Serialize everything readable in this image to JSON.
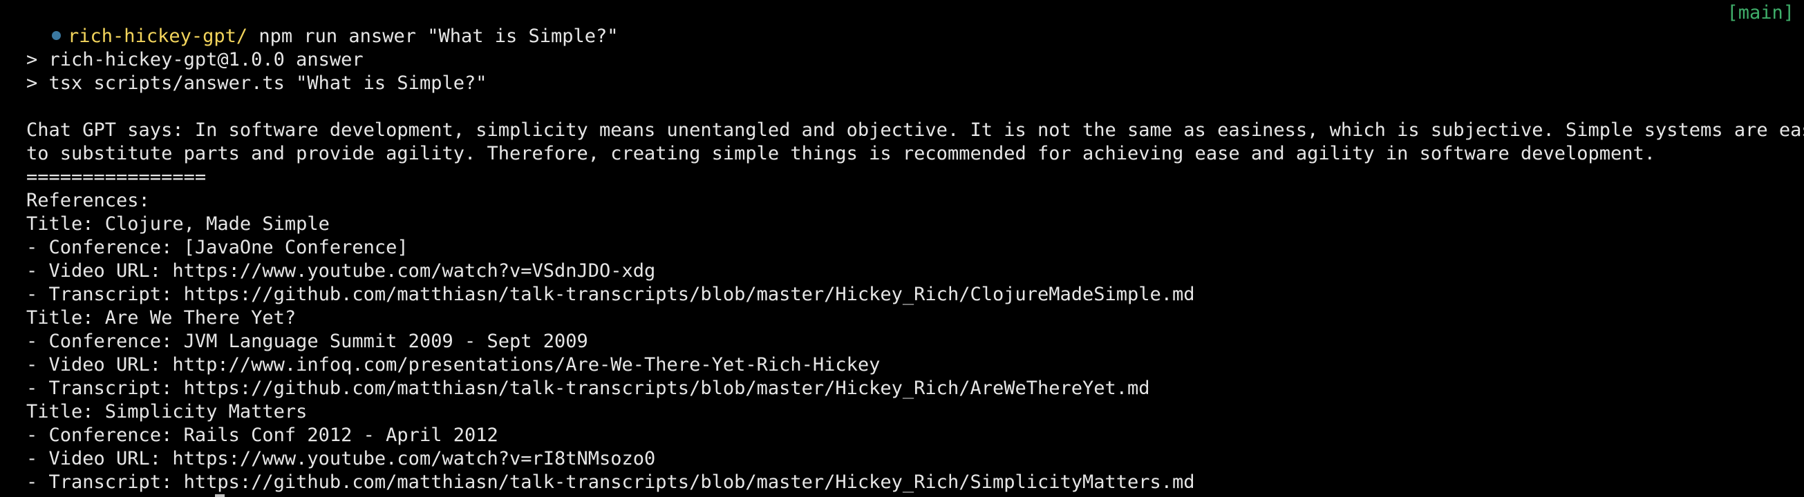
{
  "prompt": {
    "directory": "rich-hickey-gpt/",
    "command": " npm run answer \"What is Simple?\"",
    "branch": "[main]"
  },
  "npm_output": {
    "line1": "> rich-hickey-gpt@1.0.0 answer",
    "line2": "> tsx scripts/answer.ts \"What is Simple?\""
  },
  "answer": {
    "line1": "Chat GPT says: In software development, simplicity means unentangled and objective. It is not the same as easiness, which is subjective. Simple systems are easy",
    "line2": "to substitute parts and provide agility. Therefore, creating simple things is recommended for achieving ease and agility in software development."
  },
  "separator": "================",
  "references_heading": "References:",
  "references": [
    {
      "title": "Title: Clojure, Made Simple",
      "conference": "- Conference: [JavaOne Conference]",
      "video": "- Video URL: https://www.youtube.com/watch?v=VSdnJDO-xdg",
      "transcript": "- Transcript: https://github.com/matthiasn/talk-transcripts/blob/master/Hickey_Rich/ClojureMadeSimple.md"
    },
    {
      "title": "Title: Are We There Yet?",
      "conference": "- Conference: JVM Language Summit 2009 - Sept 2009",
      "video": "- Video URL: http://www.infoq.com/presentations/Are-We-There-Yet-Rich-Hickey",
      "transcript": "- Transcript: https://github.com/matthiasn/talk-transcripts/blob/master/Hickey_Rich/AreWeThereYet.md"
    },
    {
      "title": "Title: Simplicity Matters",
      "conference": "- Conference: Rails Conf 2012 - April 2012",
      "video": "- Video URL: https://www.youtube.com/watch?v=rI8tNMsozo0",
      "transcript": "- Transcript: https://github.com/matthiasn/talk-transcripts/blob/master/Hickey_Rich/SimplicityMatters.md"
    }
  ],
  "colors": {
    "background": "#000000",
    "text": "#e6e6e6",
    "directory": "#f2d45c",
    "branch": "#3fae6a",
    "prompt_dot": "#3b78a0"
  }
}
